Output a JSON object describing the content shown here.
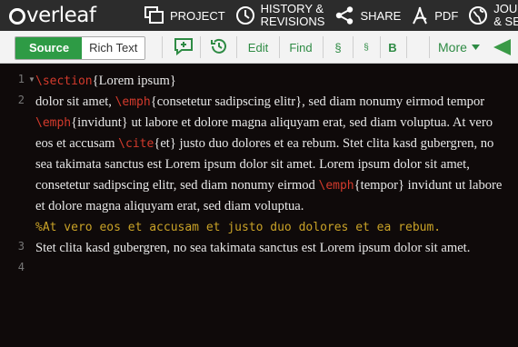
{
  "header": {
    "logo_text": "verleaf",
    "nav": [
      {
        "label": "PROJECT",
        "icon": "project-icon"
      },
      {
        "label_line1": "HISTORY &",
        "label_line2": "REVISIONS",
        "icon": "history-icon"
      },
      {
        "label": "SHARE",
        "icon": "share-icon"
      },
      {
        "label": "PDF",
        "icon": "pdf-icon"
      },
      {
        "label_line1": "JOUR",
        "label_line2": "& SER",
        "icon": "globe-icon"
      }
    ]
  },
  "toolbar": {
    "source_label": "Source",
    "rich_text_label": "Rich Text",
    "edit_label": "Edit",
    "find_label": "Find",
    "section_label": "§",
    "subsection_label": "§",
    "bold_label": "B",
    "more_label": "More"
  },
  "editor": {
    "line_numbers": [
      "1",
      "2",
      "3",
      "4"
    ],
    "line1": {
      "cmd": "\\section",
      "text": "{Lorem ipsum}"
    },
    "line2": {
      "t1": "dolor sit amet, ",
      "c1": "\\emph",
      "t2": "{consetetur sadipscing elitr}, sed diam nonumy eirmod tempor ",
      "c2": "\\emph",
      "t3": "{invidunt} ut labore et dolore magna aliquyam erat, sed diam voluptua. At vero eos et accusam ",
      "c3": "\\cite",
      "t4": "{et} justo duo dolores et ea rebum. Stet clita kasd gubergren, no sea takimata sanctus est Lorem ipsum dolor sit amet. Lorem ipsum dolor sit amet, consetetur sadipscing elitr, sed diam nonumy eirmod ",
      "c4": "\\emph",
      "t5": "{tempor} invidunt ut labore et dolore magna aliquyam erat, sed diam voluptua."
    },
    "line3": {
      "comment": "%At vero eos et accusam et justo duo dolores et ea rebum."
    },
    "line4": {
      "text": "Stet clita kasd gubergren, no sea takimata sanctus est Lorem ipsum dolor sit amet."
    }
  },
  "colors": {
    "header_bg": "#2c2c2c",
    "accent_green": "#2e9b45",
    "editor_bg": "#0f0a0a",
    "command_red": "#d33a2c",
    "comment_yellow": "#c9a227"
  }
}
